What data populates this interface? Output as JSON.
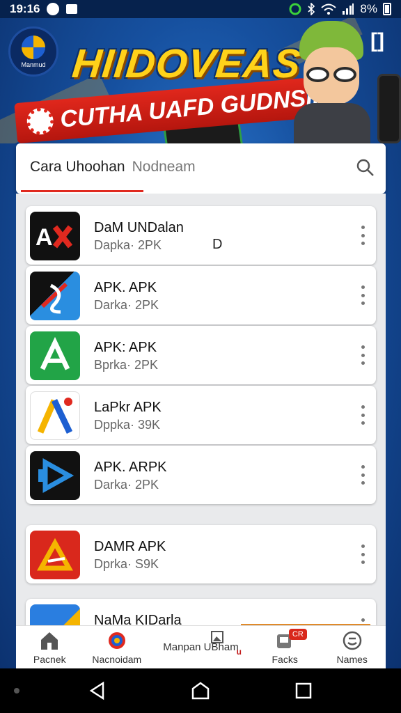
{
  "status_bar": {
    "time": "19:16",
    "battery": "8%"
  },
  "banner": {
    "logo_text": "Manmud",
    "title": "HIIDOVEAS",
    "ribbon": "CUTHA UAFD GUDNSIIN"
  },
  "search": {
    "title": "Cara Uhoohan",
    "subtitle": "Nodneam"
  },
  "apps": [
    {
      "name": "DaM UNDalan",
      "size": "Dapka· 2PK",
      "icon": "ax-logo-icon",
      "color": "#111111"
    },
    {
      "name": "APK. APK",
      "size": "Darka· 2PK",
      "icon": "puzzle-arrow-icon",
      "color": "#2a8ee0"
    },
    {
      "name": "APK: APK",
      "size": "Bprka· 2PK",
      "icon": "green-a-icon",
      "color": "#22a447"
    },
    {
      "name": "LaPkr APK",
      "size": "Dppka· 39K",
      "icon": "colorful-a-icon",
      "color": "#ffffff"
    },
    {
      "name": "APK. ARPK",
      "size": "Darka· 2PK",
      "icon": "play-d-icon",
      "color": "#111111"
    },
    {
      "name": "DAMR APK",
      "size": "Dprka· S9K",
      "icon": "red-triangle-icon",
      "color": "#d9281c"
    },
    {
      "name": "NaMa KIDarla",
      "size": "",
      "icon": "blue-yellow-icon",
      "color": "#2a7ee0"
    }
  ],
  "cursor_char": "D",
  "bottom_nav": {
    "items": [
      {
        "label": "Pacnek",
        "icon": "home-icon"
      },
      {
        "label": "Nacnoidam",
        "icon": "color-circle-icon"
      },
      {
        "label": "Manpan UBham",
        "icon": "gallery-icon"
      },
      {
        "label": "Facks",
        "icon": "packs-icon",
        "badge": "CR"
      },
      {
        "label": "Names",
        "icon": "smiley-icon"
      }
    ],
    "u_mark": "u"
  }
}
